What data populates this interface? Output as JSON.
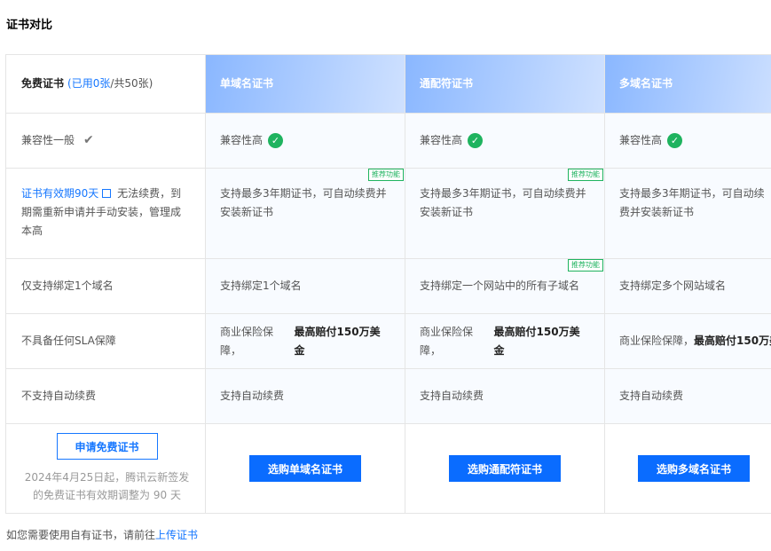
{
  "page": {
    "title": "证书对比"
  },
  "header": {
    "free_title": "免费证书",
    "free_used": "(已用0张",
    "free_total": "/共50张)",
    "columns": [
      "单域名证书",
      "通配符证书",
      "多域名证书"
    ]
  },
  "rows": {
    "compat": {
      "free": "兼容性一般",
      "paid": [
        "兼容性高",
        "兼容性高",
        "兼容性高"
      ]
    },
    "validity": {
      "free_link": "证书有效期90天",
      "free_text": "无法续费，到期需重新申请并手动安装，管理成本高",
      "paid": [
        "支持最多3年期证书，可自动续费并安装新证书",
        "支持最多3年期证书，可自动续费并安装新证书",
        "支持最多3年期证书，可自动续费并安装新证书"
      ]
    },
    "domains": {
      "free": "仅支持绑定1个域名",
      "paid": [
        "支持绑定1个域名",
        "支持绑定一个网站中的所有子域名",
        "支持绑定多个网站域名"
      ]
    },
    "sla": {
      "free": "不具备任何SLA保障",
      "paid_prefix": "商业保险保障，",
      "paid_bold": "最高赔付150万美金"
    },
    "renew": {
      "free": "不支持自动续费",
      "paid": [
        "支持自动续费",
        "支持自动续费",
        "支持自动续费"
      ]
    }
  },
  "tag_label": "推荐功能",
  "footer": {
    "apply_label": "申请免费证书",
    "apply_note": "2024年4月25日起，腾讯云新签发的免费证书有效期调整为 90 天",
    "buy_labels": [
      "选购单域名证书",
      "选购通配符证书",
      "选购多域名证书"
    ]
  },
  "bottom": {
    "text": "如您需要使用自有证书，请前往",
    "link": "上传证书"
  }
}
